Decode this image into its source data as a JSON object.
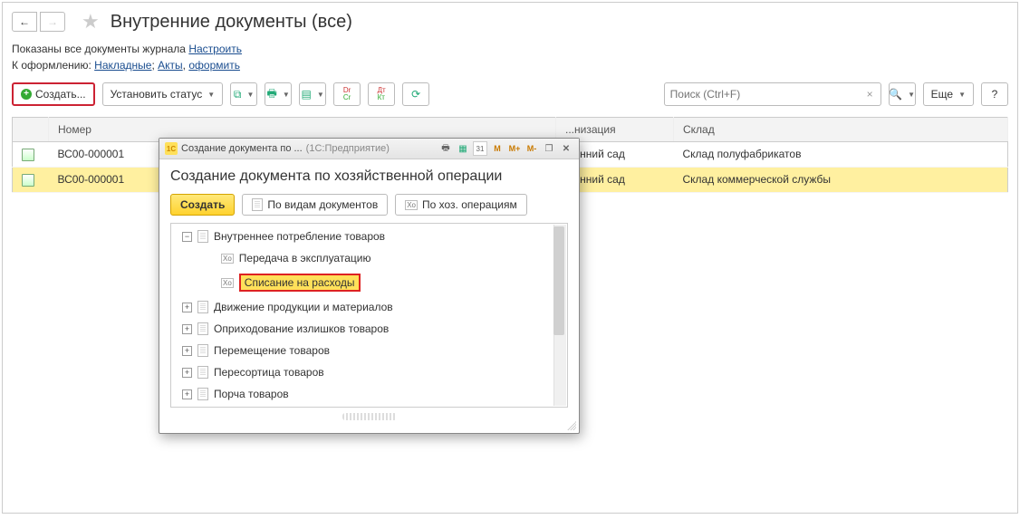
{
  "header": {
    "title": "Внутренние документы (все)"
  },
  "info1_prefix": "Показаны все документы журнала ",
  "info1_link": "Настроить",
  "info2_prefix": "К оформлению: ",
  "info2_link1": "Накладные",
  "info2_sep1": "; ",
  "info2_link2": "Акты",
  "info2_sep2": ", ",
  "info2_link3": "оформить",
  "toolbar": {
    "create": "Создать...",
    "set_status": "Установить статус",
    "more": "Еще",
    "help": "?",
    "search_placeholder": "Поиск (Ctrl+F)"
  },
  "table": {
    "col_number": "Номер",
    "col_org": "...низация",
    "col_store": "Склад",
    "rows": [
      {
        "num": "ВС00-000001",
        "org": "...енний сад",
        "store": "Склад полуфабрикатов"
      },
      {
        "num": "ВС00-000001",
        "org": "...енний сад",
        "store": "Склад коммерческой службы"
      }
    ]
  },
  "modal": {
    "titlebar_left": "Создание документа по ...",
    "titlebar_right": "(1С:Предприятие)",
    "mem_m": "M",
    "mem_mp": "M+",
    "mem_mm": "M-",
    "cal_31": "31",
    "heading": "Создание документа по хозяйственной операции",
    "btn_create": "Создать",
    "btn_by_docs": "По видам документов",
    "btn_by_ops": "По хоз. операциям",
    "tree": [
      {
        "lvl": 1,
        "exp": "minus",
        "ico": "doc",
        "label": "Внутреннее потребление товаров"
      },
      {
        "lvl": 2,
        "exp": "none",
        "ico": "xo",
        "label": "Передача в эксплуатацию"
      },
      {
        "lvl": 2,
        "exp": "none",
        "ico": "xo",
        "label": "Списание на расходы",
        "selected": true
      },
      {
        "lvl": 1,
        "exp": "plus",
        "ico": "doc",
        "label": "Движение продукции и материалов"
      },
      {
        "lvl": 1,
        "exp": "plus",
        "ico": "doc",
        "label": "Оприходование излишков товаров"
      },
      {
        "lvl": 1,
        "exp": "plus",
        "ico": "doc",
        "label": "Перемещение товаров"
      },
      {
        "lvl": 1,
        "exp": "plus",
        "ico": "doc",
        "label": "Пересортица товаров"
      },
      {
        "lvl": 1,
        "exp": "plus",
        "ico": "doc",
        "label": "Порча товаров"
      }
    ]
  }
}
